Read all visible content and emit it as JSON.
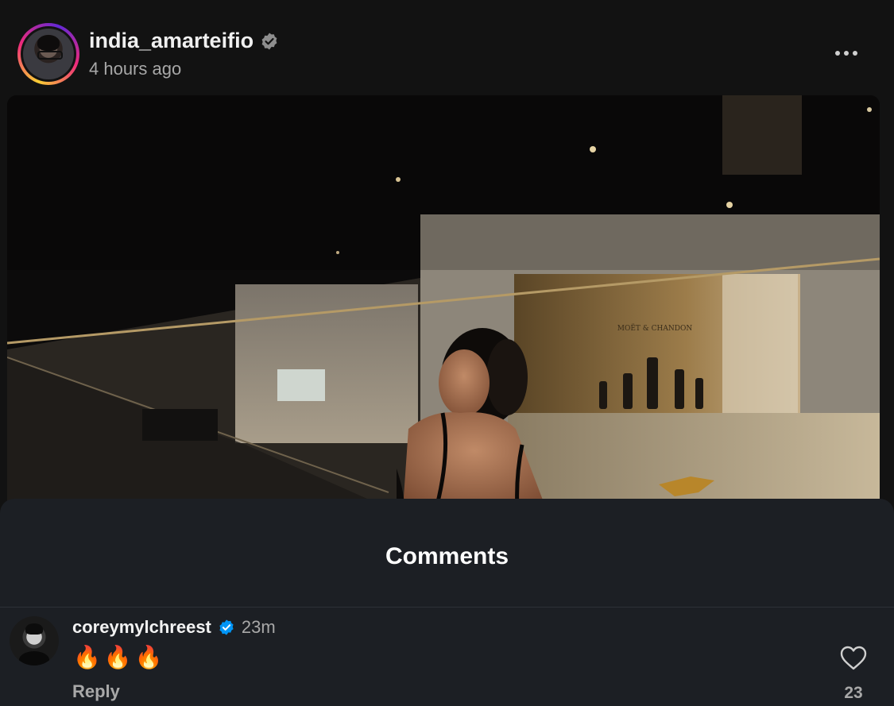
{
  "post": {
    "username": "india_amarteifio",
    "timestamp": "4 hours ago",
    "verified": true,
    "more_icon": "more-horizontal-icon",
    "image_sign_text": "MOËT & CHANDON"
  },
  "comments_sheet": {
    "title": "Comments",
    "comments": [
      {
        "username": "coreymylchreest",
        "verified": true,
        "time": "23m",
        "text": "🔥🔥🔥",
        "reply_label": "Reply",
        "like_count": "23",
        "like_icon": "heart-outline-icon"
      }
    ]
  },
  "colors": {
    "background": "#121212",
    "sheet": "#1c1f24",
    "verified_blue": "#0095f6",
    "secondary_text": "#a8a8a8"
  }
}
